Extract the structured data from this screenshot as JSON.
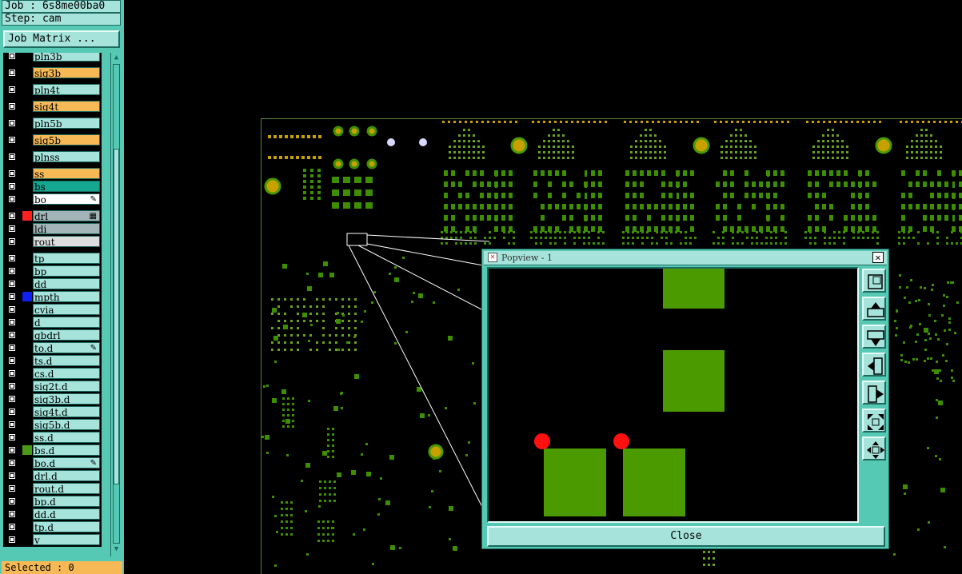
{
  "header": {
    "job": "Job : 6s8me00ba0",
    "step": "Step: cam"
  },
  "job_matrix_label": "Job Matrix ...",
  "layers": [
    {
      "name": "pln3b",
      "color": "#a5e3db"
    },
    {
      "name": "sig3b",
      "color": "#f7b955"
    },
    {
      "name": "pln4t",
      "color": "#a5e3db"
    },
    {
      "name": "sig4t",
      "color": "#f7b955"
    },
    {
      "name": "pln5b",
      "color": "#a5e3db"
    },
    {
      "name": "sig5b",
      "color": "#f7b955"
    },
    {
      "name": "plnss",
      "color": "#a5e3db"
    },
    {
      "name": "ss",
      "color": "#f7b955"
    },
    {
      "name": "bs",
      "color": "#13a88f"
    },
    {
      "name": "bo",
      "color": "#ffffff",
      "mark": "✎"
    },
    {
      "name": "drl",
      "color": "#a3b5b8",
      "swatch": "#ff2020",
      "checked": true,
      "mark": "▦"
    },
    {
      "name": "ldi",
      "color": "#a3b5b8"
    },
    {
      "name": "rout",
      "color": "#dddddd"
    },
    {
      "name": "tp",
      "color": "#a5e3db"
    },
    {
      "name": "bp",
      "color": "#a5e3db"
    },
    {
      "name": "dd",
      "color": "#a5e3db"
    },
    {
      "name": "mpth",
      "color": "#a5e3db",
      "swatch": "#1020f0"
    },
    {
      "name": "cvia",
      "color": "#a5e3db"
    },
    {
      "name": "d",
      "color": "#a5e3db"
    },
    {
      "name": "gbdrl",
      "color": "#a5e3db"
    },
    {
      "name": "to.d",
      "color": "#a5e3db",
      "mark": "✎"
    },
    {
      "name": "ts.d",
      "color": "#a5e3db"
    },
    {
      "name": "cs.d",
      "color": "#a5e3db"
    },
    {
      "name": "sig2t.d",
      "color": "#a5e3db"
    },
    {
      "name": "sig3b.d",
      "color": "#a5e3db"
    },
    {
      "name": "sig4t.d",
      "color": "#a5e3db"
    },
    {
      "name": "sig5b.d",
      "color": "#a5e3db"
    },
    {
      "name": "ss.d",
      "color": "#a5e3db"
    },
    {
      "name": "bs.d",
      "color": "#a5e3db",
      "swatch": "#4a9a1a"
    },
    {
      "name": "bo.d",
      "color": "#a5e3db",
      "mark": "✎"
    },
    {
      "name": "drl.d",
      "color": "#a5e3db"
    },
    {
      "name": "rout.d",
      "color": "#a5e3db"
    },
    {
      "name": "bp.d",
      "color": "#a5e3db"
    },
    {
      "name": "dd.d",
      "color": "#a5e3db"
    },
    {
      "name": "tp.d",
      "color": "#a5e3db"
    },
    {
      "name": "v",
      "color": "#a5e3db"
    }
  ],
  "selected": "Selected : 0",
  "popview": {
    "title": "Popview - 1",
    "close_label": "Close",
    "tools": [
      "zoom-fit-icon",
      "pan-up-icon",
      "pan-down-icon",
      "pan-left-icon",
      "pan-right-icon",
      "zoom-in-icon",
      "zoom-out-icon"
    ]
  },
  "colors": {
    "panel": "#56c9b4",
    "panel_light": "#a5e3db",
    "feature_green": "#3d8f00",
    "pad_fill": "#4a9a00",
    "drill_red": "#ff1010"
  }
}
